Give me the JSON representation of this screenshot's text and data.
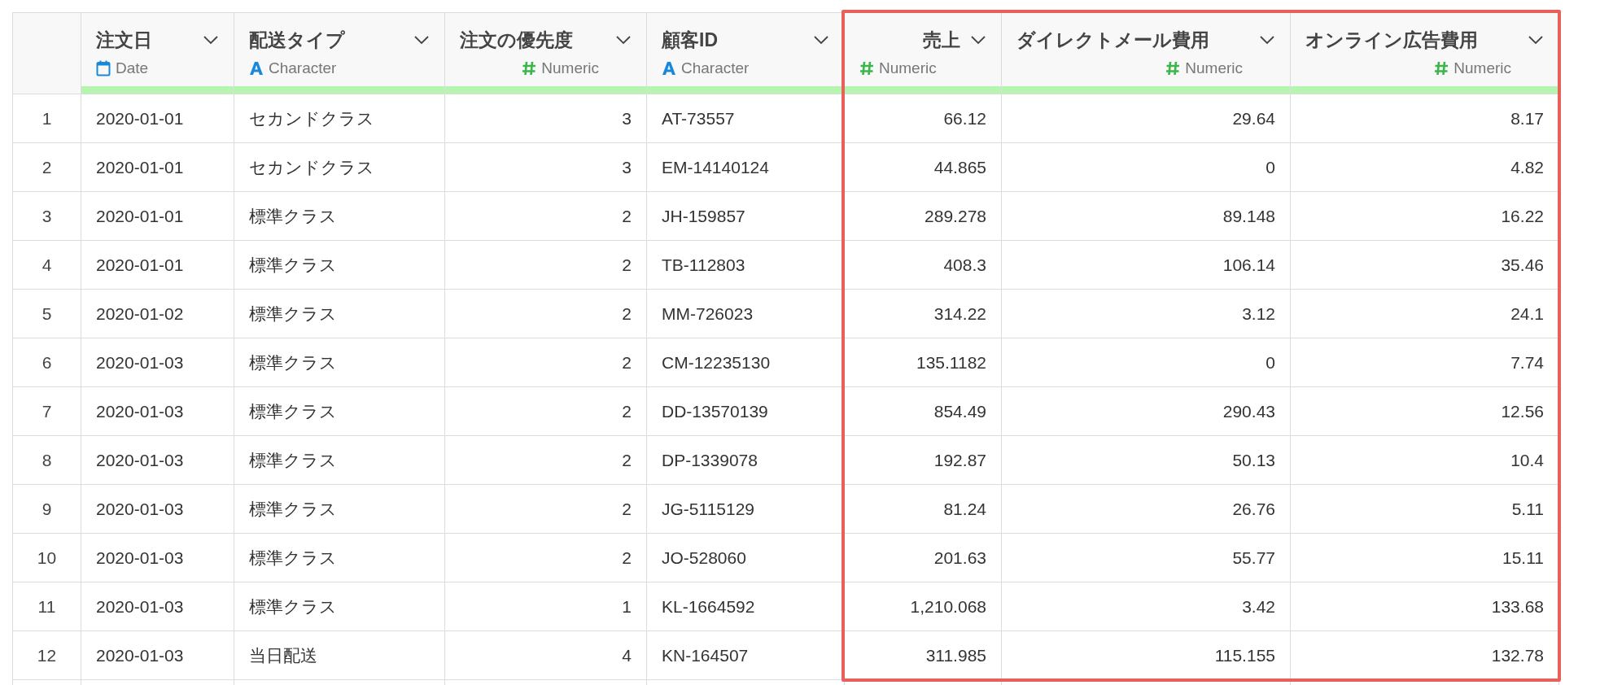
{
  "table": {
    "columns": [
      {
        "title": "注文日",
        "kind": "date",
        "type_label": "Date",
        "highlighted": false
      },
      {
        "title": "配送タイプ",
        "kind": "character",
        "type_label": "Character",
        "highlighted": false
      },
      {
        "title": "注文の優先度",
        "kind": "numeric",
        "type_label": "Numeric",
        "highlighted": false
      },
      {
        "title": "顧客ID",
        "kind": "character",
        "type_label": "Character",
        "highlighted": false
      },
      {
        "title": "売上",
        "kind": "numeric",
        "type_label": "Numeric",
        "highlighted": true
      },
      {
        "title": "ダイレクトメール費用",
        "kind": "numeric",
        "type_label": "Numeric",
        "highlighted": true
      },
      {
        "title": "オンライン広告費用",
        "kind": "numeric",
        "type_label": "Numeric",
        "highlighted": true
      }
    ],
    "rows": [
      {
        "number": "1",
        "cells": [
          "2020-01-01",
          "セカンドクラス",
          "3",
          "AT-73557",
          "66.12",
          "29.64",
          "8.17"
        ]
      },
      {
        "number": "2",
        "cells": [
          "2020-01-01",
          "セカンドクラス",
          "3",
          "EM-14140124",
          "44.865",
          "0",
          "4.82"
        ]
      },
      {
        "number": "3",
        "cells": [
          "2020-01-01",
          "標準クラス",
          "2",
          "JH-159857",
          "289.278",
          "89.148",
          "16.22"
        ]
      },
      {
        "number": "4",
        "cells": [
          "2020-01-01",
          "標準クラス",
          "2",
          "TB-112803",
          "408.3",
          "106.14",
          "35.46"
        ]
      },
      {
        "number": "5",
        "cells": [
          "2020-01-02",
          "標準クラス",
          "2",
          "MM-726023",
          "314.22",
          "3.12",
          "24.1"
        ]
      },
      {
        "number": "6",
        "cells": [
          "2020-01-03",
          "標準クラス",
          "2",
          "CM-12235130",
          "135.1182",
          "0",
          "7.74"
        ]
      },
      {
        "number": "7",
        "cells": [
          "2020-01-03",
          "標準クラス",
          "2",
          "DD-13570139",
          "854.49",
          "290.43",
          "12.56"
        ]
      },
      {
        "number": "8",
        "cells": [
          "2020-01-03",
          "標準クラス",
          "2",
          "DP-1339078",
          "192.87",
          "50.13",
          "10.4"
        ]
      },
      {
        "number": "9",
        "cells": [
          "2020-01-03",
          "標準クラス",
          "2",
          "JG-5115129",
          "81.24",
          "26.76",
          "5.11"
        ]
      },
      {
        "number": "10",
        "cells": [
          "2020-01-03",
          "標準クラス",
          "2",
          "JO-528060",
          "201.63",
          "55.77",
          "15.11"
        ]
      },
      {
        "number": "11",
        "cells": [
          "2020-01-03",
          "標準クラス",
          "1",
          "KL-1664592",
          "1,210.068",
          "3.42",
          "133.68"
        ]
      },
      {
        "number": "12",
        "cells": [
          "2020-01-03",
          "当日配送",
          "4",
          "KN-164507",
          "311.985",
          "115.155",
          "132.78"
        ]
      }
    ]
  }
}
